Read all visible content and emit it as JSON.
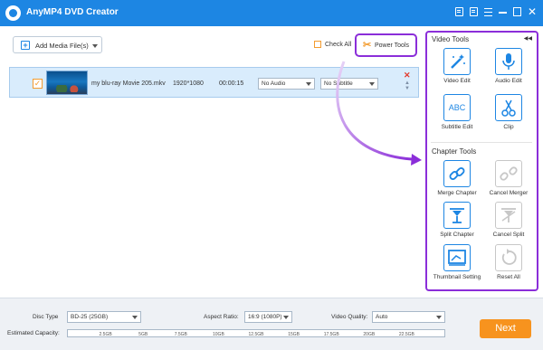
{
  "app": {
    "title": "AnyMP4 DVD Creator"
  },
  "toolbar": {
    "add_media_label": "Add Media File(s)",
    "check_all_label": "Check All",
    "power_tools_label": "Power Tools"
  },
  "file": {
    "name": "my blu-ray Movie 205.mkv",
    "resolution": "1920*1080",
    "duration": "00:00:15",
    "audio": "No Audio",
    "subtitle": "No Subtitle"
  },
  "panel": {
    "video_tools_title": "Video Tools",
    "chapter_tools_title": "Chapter Tools",
    "video_tools": [
      {
        "label": "Video Edit",
        "icon": "magic-wand-icon"
      },
      {
        "label": "Audio Edit",
        "icon": "microphone-icon"
      },
      {
        "label": "Subtitle Edit",
        "icon": "abc-icon",
        "glyph": "ABC"
      },
      {
        "label": "Clip",
        "icon": "scissors-icon"
      }
    ],
    "chapter_tools": [
      {
        "label": "Merge Chapter",
        "icon": "link-icon",
        "enabled": true
      },
      {
        "label": "Cancel Merger",
        "icon": "unlink-icon",
        "enabled": false
      },
      {
        "label": "Split Chapter",
        "icon": "split-icon",
        "enabled": true
      },
      {
        "label": "Cancel Split",
        "icon": "cancel-split-icon",
        "enabled": false
      },
      {
        "label": "Thumbnail Setting",
        "icon": "thumbnail-icon",
        "enabled": true
      },
      {
        "label": "Reset All",
        "icon": "reset-icon",
        "enabled": false
      }
    ]
  },
  "bottom": {
    "disc_type_label": "Disc Type",
    "disc_type_value": "BD-25 (25GB)",
    "aspect_ratio_label": "Aspect Ratio:",
    "aspect_ratio_value": "16:9 (1080P)",
    "video_quality_label": "Video Quality:",
    "video_quality_value": "Auto",
    "capacity_label": "Estimated Capacity:",
    "capacity_ticks": [
      "2.5GB",
      "5GB",
      "7.5GB",
      "10GB",
      "12.5GB",
      "15GB",
      "17.5GB",
      "20GB",
      "22.5GB"
    ],
    "next_label": "Next"
  },
  "colors": {
    "titlebar": "#1d86e3",
    "accent_purple": "#8b2ed9",
    "next_button": "#f7931e",
    "icon_blue": "#1d86e3"
  }
}
